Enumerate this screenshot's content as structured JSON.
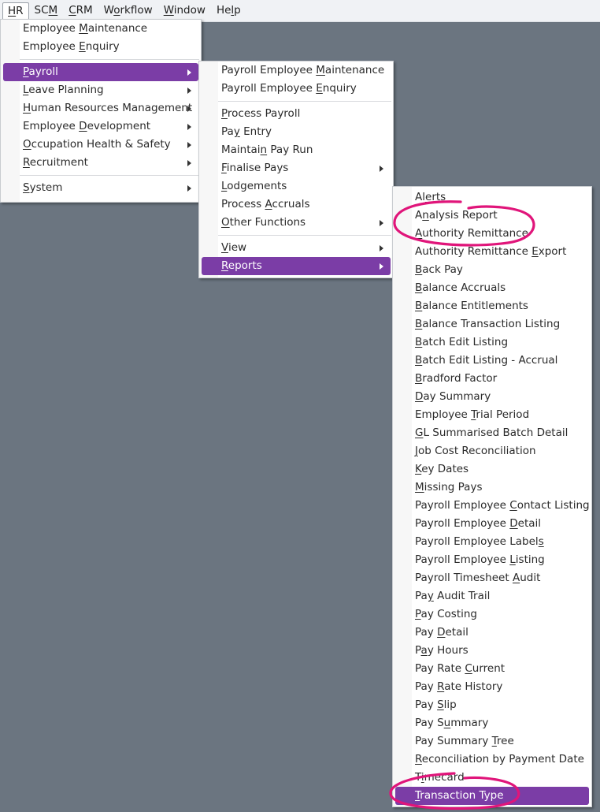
{
  "menubar": {
    "items": [
      {
        "pre": "",
        "key": "H",
        "post": "R",
        "active": true
      },
      {
        "pre": "SC",
        "key": "M",
        "post": "",
        "active": false
      },
      {
        "pre": "",
        "key": "C",
        "post": "RM",
        "active": false
      },
      {
        "pre": "W",
        "key": "o",
        "post": "rkflow",
        "active": false
      },
      {
        "pre": "",
        "key": "W",
        "post": "indow",
        "active": false
      },
      {
        "pre": "He",
        "key": "l",
        "post": "p",
        "active": false
      }
    ]
  },
  "hr_menu": {
    "groups": [
      [
        {
          "pre": "Employee ",
          "key": "M",
          "post": "aintenance",
          "submenu": false
        },
        {
          "pre": "Employee ",
          "key": "E",
          "post": "nquiry",
          "submenu": false
        }
      ],
      [
        {
          "pre": "",
          "key": "P",
          "post": "ayroll",
          "submenu": true,
          "highlighted": true
        },
        {
          "pre": "",
          "key": "L",
          "post": "eave Planning",
          "submenu": true
        },
        {
          "pre": "",
          "key": "H",
          "post": "uman Resources Management",
          "submenu": true
        },
        {
          "pre": "Employee ",
          "key": "D",
          "post": "evelopment",
          "submenu": true
        },
        {
          "pre": "",
          "key": "O",
          "post": "ccupation Health & Safety",
          "submenu": true
        },
        {
          "pre": "",
          "key": "R",
          "post": "ecruitment",
          "submenu": true
        }
      ],
      [
        {
          "pre": "",
          "key": "S",
          "post": "ystem",
          "submenu": true
        }
      ]
    ]
  },
  "payroll_menu": {
    "groups": [
      [
        {
          "pre": "Payroll Employee ",
          "key": "M",
          "post": "aintenance",
          "submenu": false
        },
        {
          "pre": "Payroll Employee ",
          "key": "E",
          "post": "nquiry",
          "submenu": false
        }
      ],
      [
        {
          "pre": "",
          "key": "P",
          "post": "rocess Payroll",
          "submenu": false
        },
        {
          "pre": "Pa",
          "key": "y",
          "post": " Entry",
          "submenu": false
        },
        {
          "pre": "Maintai",
          "key": "n",
          "post": " Pay Run",
          "submenu": false
        },
        {
          "pre": "",
          "key": "F",
          "post": "inalise Pays",
          "submenu": true
        },
        {
          "pre": "",
          "key": "L",
          "post": "odgements",
          "submenu": false
        },
        {
          "pre": "Process ",
          "key": "A",
          "post": "ccruals",
          "submenu": false
        },
        {
          "pre": "",
          "key": "O",
          "post": "ther Functions",
          "submenu": true
        }
      ],
      [
        {
          "pre": "",
          "key": "V",
          "post": "iew",
          "submenu": true
        },
        {
          "pre": "",
          "key": "R",
          "post": "eports",
          "submenu": true,
          "highlighted": true
        }
      ]
    ]
  },
  "reports_menu": {
    "items": [
      {
        "pre": "Al",
        "key": "e",
        "post": "rts"
      },
      {
        "pre": "A",
        "key": "n",
        "post": "alysis Report"
      },
      {
        "pre": "",
        "key": "A",
        "post": "uthority Remittance"
      },
      {
        "pre": "Authority Remittance ",
        "key": "E",
        "post": "xport"
      },
      {
        "pre": "",
        "key": "B",
        "post": "ack Pay"
      },
      {
        "pre": "",
        "key": "B",
        "post": "alance Accruals"
      },
      {
        "pre": "",
        "key": "B",
        "post": "alance Entitlements"
      },
      {
        "pre": "",
        "key": "B",
        "post": "alance Transaction Listing"
      },
      {
        "pre": "",
        "key": "B",
        "post": "atch Edit Listing"
      },
      {
        "pre": "",
        "key": "B",
        "post": "atch Edit Listing - Accrual"
      },
      {
        "pre": "",
        "key": "B",
        "post": "radford Factor"
      },
      {
        "pre": "",
        "key": "D",
        "post": "ay Summary"
      },
      {
        "pre": "Employee ",
        "key": "T",
        "post": "rial Period"
      },
      {
        "pre": "",
        "key": "G",
        "post": "L Summarised Batch Detail"
      },
      {
        "pre": "",
        "key": "J",
        "post": "ob Cost Reconciliation"
      },
      {
        "pre": "",
        "key": "K",
        "post": "ey Dates"
      },
      {
        "pre": "",
        "key": "M",
        "post": "issing Pays"
      },
      {
        "pre": "Payroll Employee ",
        "key": "C",
        "post": "ontact Listing"
      },
      {
        "pre": "Payroll Employee ",
        "key": "D",
        "post": "etail"
      },
      {
        "pre": "Payroll Employee Label",
        "key": "s",
        "post": ""
      },
      {
        "pre": "Payroll Employee ",
        "key": "L",
        "post": "isting"
      },
      {
        "pre": "Payroll Timesheet ",
        "key": "A",
        "post": "udit"
      },
      {
        "pre": "Pa",
        "key": "y",
        "post": " Audit Trail"
      },
      {
        "pre": "",
        "key": "P",
        "post": "ay Costing"
      },
      {
        "pre": "Pay ",
        "key": "D",
        "post": "etail"
      },
      {
        "pre": "P",
        "key": "a",
        "post": "y Hours"
      },
      {
        "pre": "Pay Rate ",
        "key": "C",
        "post": "urrent"
      },
      {
        "pre": "Pay ",
        "key": "R",
        "post": "ate History"
      },
      {
        "pre": "Pay ",
        "key": "S",
        "post": "lip"
      },
      {
        "pre": "Pay S",
        "key": "u",
        "post": "mmary"
      },
      {
        "pre": "Pay Summary ",
        "key": "T",
        "post": "ree"
      },
      {
        "pre": "",
        "key": "R",
        "post": "econciliation by Payment Date"
      },
      {
        "pre": "T",
        "key": "i",
        "post": "mecard"
      },
      {
        "pre": "",
        "key": "T",
        "post": "ransaction Type",
        "highlighted": true
      }
    ]
  },
  "colors": {
    "highlight": "#7b3da6",
    "annotation": "#e0157a",
    "desktop": "#6b7580"
  }
}
